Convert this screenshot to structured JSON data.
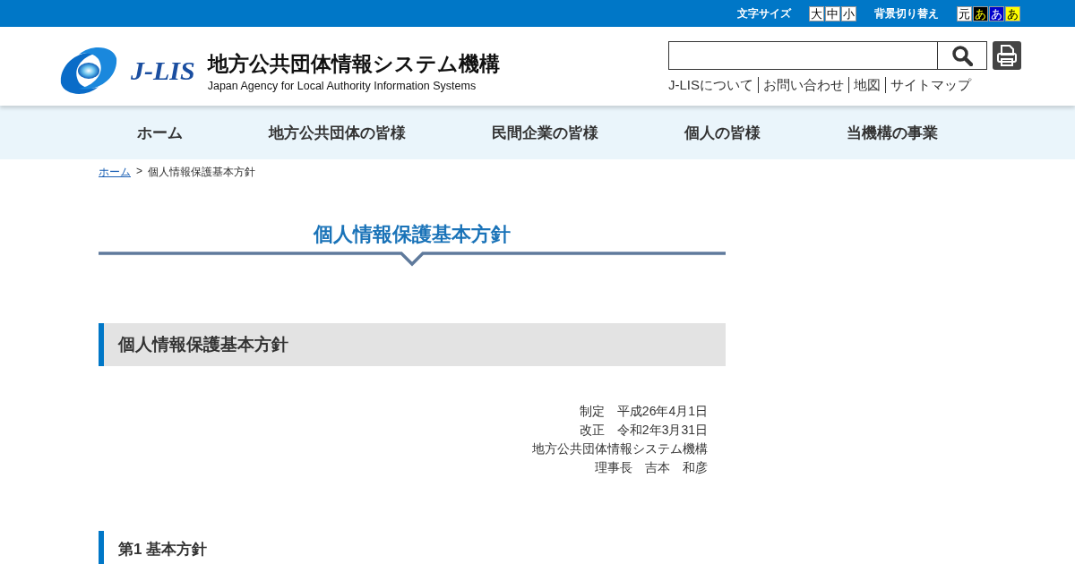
{
  "top_bar": {
    "font_size_label": "文字サイズ",
    "font_sizes": [
      {
        "label": "大",
        "selected": false
      },
      {
        "label": "中",
        "selected": false
      },
      {
        "label": "小",
        "selected": false
      }
    ],
    "background_label": "背景切り替え",
    "backgrounds": [
      {
        "label": "元",
        "kind": "default",
        "color": "#ffffff"
      },
      {
        "label": "あ",
        "kind": "black",
        "color": "#000000"
      },
      {
        "label": "あ",
        "kind": "blue",
        "color": "#0000cc"
      },
      {
        "label": "あ",
        "kind": "yellow",
        "color": "#ffff00"
      }
    ]
  },
  "header": {
    "logo_text": "J-LIS",
    "site_title": "地方公共団体情報システム機構",
    "site_subtitle": "Japan Agency for Local Authority Information Systems",
    "utility_links": [
      "J-LISについて",
      "お問い合わせ",
      "地図",
      "サイトマップ"
    ]
  },
  "nav": [
    "ホーム",
    "地方公共団体の皆様",
    "民間企業の皆様",
    "個人の皆様",
    "当機構の事業"
  ],
  "breadcrumb": {
    "link": "ホーム",
    "separator": ">",
    "current": "個人情報保護基本方針"
  },
  "page_title": "個人情報保護基本方針",
  "section_title": "個人情報保護基本方針",
  "signature": [
    "制定　平成26年4月1日",
    "改正　令和2年3月31日",
    "地方公共団体情報システム機構",
    "理事長　吉本　和彦"
  ],
  "subsection_title": "第1 基本方針"
}
